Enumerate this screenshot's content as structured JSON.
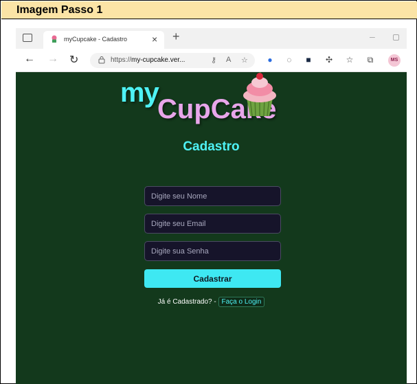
{
  "caption": "Imagem Passo 1",
  "browser": {
    "tab_title": "myCupcake - Cadastro",
    "url_prefix": "https://",
    "url_host": "my-cupcake.ver...",
    "profile_initials": "MS",
    "icons": [
      "tab-actions-icon",
      "cupcake-favicon",
      "close-icon",
      "plus-icon",
      "back-arrow-icon",
      "forward-arrow-icon",
      "reload-icon",
      "lock-icon",
      "key-icon",
      "read-aloud-icon",
      "favorite-add-icon",
      "extension-icon",
      "extension-icon",
      "extension-icon",
      "puzzle-icon",
      "favorites-icon",
      "collections-icon"
    ]
  },
  "page": {
    "logo_my": "my",
    "logo_cupcake": "CupCake",
    "title": "Cadastro",
    "name_placeholder": "Digite seu Nome",
    "email_placeholder": "Digite seu Email",
    "password_placeholder": "Digite sua Senha",
    "submit_label": "Cadastrar",
    "login_prompt": "Já é Cadastrado? -",
    "login_link": "Faça o Login"
  },
  "colors": {
    "background": "#13391c",
    "accent": "#4ef2f5",
    "logo_pink": "#e8a6ea",
    "input_bg": "#16142a"
  }
}
